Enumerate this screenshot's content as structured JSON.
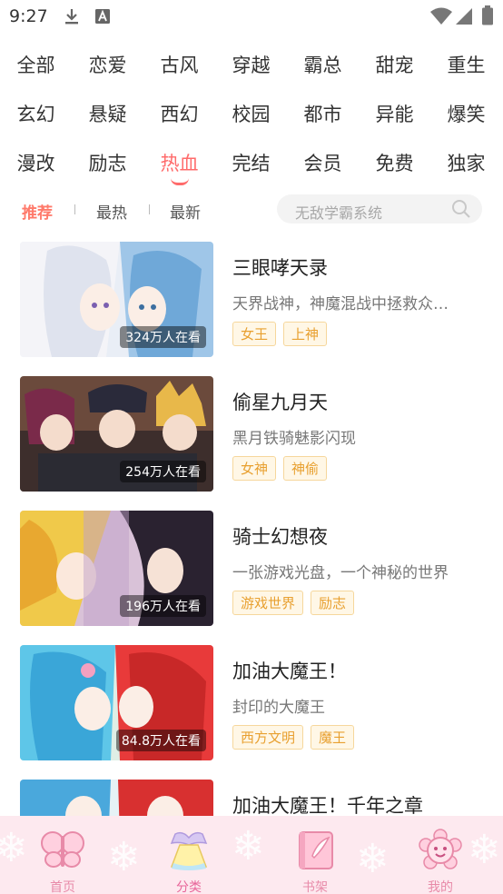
{
  "status_bar": {
    "time": "9:27"
  },
  "categories": [
    [
      "全部",
      "恋爱",
      "古风",
      "穿越",
      "霸总",
      "甜宠",
      "重生"
    ],
    [
      "玄幻",
      "悬疑",
      "西幻",
      "校园",
      "都市",
      "异能",
      "爆笑"
    ],
    [
      "漫改",
      "励志",
      "热血",
      "完结",
      "会员",
      "免费",
      "独家"
    ]
  ],
  "active_category": "热血",
  "sort_tabs": [
    "推荐",
    "最热",
    "最新"
  ],
  "search": {
    "placeholder": "无敌学霸系统"
  },
  "comics": [
    {
      "title": "三眼哮天录",
      "description": "天界战神，神魔混战中拯救众…",
      "tags": [
        "女王",
        "上神"
      ],
      "viewers": "324万人在看"
    },
    {
      "title": "偷星九月天",
      "description": "黑月铁骑魅影闪现",
      "tags": [
        "女神",
        "神偷"
      ],
      "viewers": "254万人在看"
    },
    {
      "title": "骑士幻想夜",
      "description": "一张游戏光盘，一个神秘的世界",
      "tags": [
        "游戏世界",
        "励志"
      ],
      "viewers": "196万人在看"
    },
    {
      "title": "加油大魔王！",
      "description": "封印的大魔王",
      "tags": [
        "西方文明",
        "魔王"
      ],
      "viewers": "84.8万人在看"
    },
    {
      "title": "加油大魔王！千年之章",
      "description": "",
      "tags": [],
      "viewers": ""
    }
  ],
  "bottom_nav": [
    {
      "label": "首页",
      "icon": "butterfly-icon"
    },
    {
      "label": "分类",
      "icon": "dress-icon"
    },
    {
      "label": "书架",
      "icon": "book-icon"
    },
    {
      "label": "我的",
      "icon": "flower-face-icon"
    }
  ],
  "colors": {
    "accent": "#ff6b6b",
    "tag_text": "#e8a030",
    "tag_bg": "#fff7e6",
    "nav_bg": "#fde9ef",
    "nav_label": "#e88aa8"
  }
}
